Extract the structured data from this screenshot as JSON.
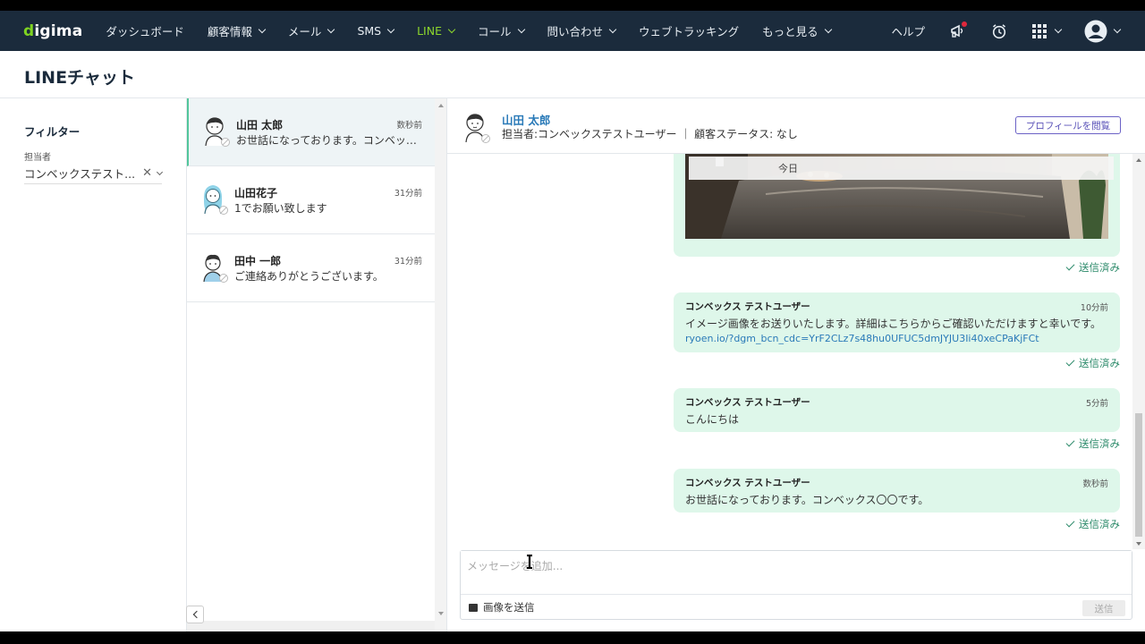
{
  "nav": {
    "logo": "digima",
    "items": [
      {
        "label": "ダッシュボード",
        "chevron": false,
        "active": false
      },
      {
        "label": "顧客情報",
        "chevron": true,
        "active": false
      },
      {
        "label": "メール",
        "chevron": true,
        "active": false
      },
      {
        "label": "SMS",
        "chevron": true,
        "active": false
      },
      {
        "label": "LINE",
        "chevron": true,
        "active": true
      },
      {
        "label": "コール",
        "chevron": true,
        "active": false
      },
      {
        "label": "問い合わせ",
        "chevron": true,
        "active": false
      },
      {
        "label": "ウェブトラッキング",
        "chevron": false,
        "active": false
      },
      {
        "label": "もっと見る",
        "chevron": true,
        "active": false
      }
    ],
    "help": "ヘルプ",
    "icons": [
      "megaphone-icon",
      "alarm-clock-icon",
      "apps-grid-icon",
      "user-avatar-icon"
    ],
    "colors": {
      "bg": "#1b2b3c",
      "active": "#8dd62c"
    }
  },
  "page": {
    "title": "LINEチャット"
  },
  "filter": {
    "title": "フィルター",
    "assignee_label": "担当者",
    "assignee_value": "コンベックステスト..."
  },
  "conversations": [
    {
      "name": "山田 太郎",
      "time": "数秒前",
      "message": "お世話になっております。コンベックス〇〇です。",
      "active": true
    },
    {
      "name": "山田花子",
      "time": "31分前",
      "message": "1でお願い致します",
      "active": false
    },
    {
      "name": "田中 一郎",
      "time": "31分前",
      "message": "ご連絡ありがとうございます。",
      "active": false
    }
  ],
  "chat": {
    "contact_name": "山田 太郎",
    "subtitle": "担当者:コンベックステストユーザー ｜ 顧客ステータス: なし",
    "profile_button": "プロフィールを閲覧",
    "date_divider": "今日",
    "messages": [
      {
        "type": "image",
        "status": "送信済み"
      },
      {
        "type": "text",
        "sender": "コンベックス テストユーザー",
        "time": "10分前",
        "text": "イメージ画像をお送りいたします。詳細はこちらからご確認いただけますと幸いです。",
        "link": "ryoen.io/?dgm_bcn_cdc=YrF2CLz7s48hu0UFUC5dmJYJU3Ii40xeCPaKjFCt",
        "status": "送信済み"
      },
      {
        "type": "text",
        "sender": "コンベックス テストユーザー",
        "time": "5分前",
        "text": "こんにちは",
        "status": "送信済み"
      },
      {
        "type": "text",
        "sender": "コンベックス テストユーザー",
        "time": "数秒前",
        "text": "お世話になっております。コンベックス〇〇です。",
        "status": "送信済み"
      }
    ],
    "composer": {
      "placeholder": "メッセージを追加...",
      "attach_label": "画像を送信",
      "send_label": "送信"
    }
  }
}
